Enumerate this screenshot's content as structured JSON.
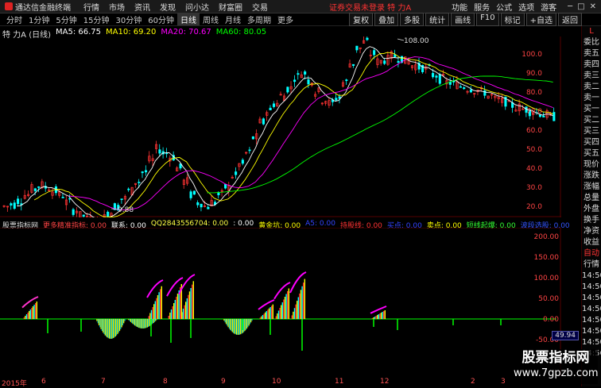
{
  "app": {
    "title": "通达信金融终端",
    "menu": [
      "行情",
      "市场",
      "资讯",
      "发现",
      "问小达",
      "财富圈",
      "交易"
    ],
    "notice": "证券交易未登录  特 力A",
    "right_menu": [
      "功能",
      "服务",
      "公式",
      "选项"
    ],
    "guest": "游客"
  },
  "toolbar": {
    "periods": [
      "分时",
      "1分钟",
      "5分钟",
      "15分钟",
      "30分钟",
      "60分钟",
      "日线",
      "周线",
      "月线",
      "多周期",
      "更多"
    ],
    "active": "日线",
    "actions": [
      "复权",
      "叠加",
      "多股",
      "统计",
      "画线",
      "F10",
      "标记",
      "+自选",
      "返回"
    ]
  },
  "info": {
    "name": "特 力A (日线)",
    "ma5": "MA5: 66.75",
    "ma10": "MA10: 69.20",
    "ma20": "MA20: 70.67",
    "ma60": "MA60: 80.05"
  },
  "price_axis": [
    "100.0",
    "90.0",
    "80.0",
    "70.0",
    "60.0",
    "50.0",
    "40.0",
    "30.0",
    "20.0"
  ],
  "price_labels": {
    "high": "108.00",
    "low": "9.88"
  },
  "indicator": {
    "title": "股票指标网",
    "items": [
      {
        "text": "更多精准指标: 0.00",
        "color": "#ff4444"
      },
      {
        "text": "联系: 0.00",
        "color": "#ffffff"
      },
      {
        "text": "QQ2843556704: 0.00",
        "color": "#ffff44"
      },
      {
        "text": ": 0.00",
        "color": "#ffffff"
      },
      {
        "text": "黄金坑: 0.00",
        "color": "#ffff00"
      },
      {
        "text": "A5: 0.00",
        "color": "#3344ff"
      },
      {
        "text": "持股线: 0.00",
        "color": "#ff3333"
      },
      {
        "text": "买点: 0.00",
        "color": "#3344ff"
      },
      {
        "text": "卖点: 0.00",
        "color": "#ffff00"
      },
      {
        "text": "短线起爆: 0.00",
        "color": "#33ff33"
      },
      {
        "text": "波段选股: 0.00",
        "color": "#3355ff"
      }
    ]
  },
  "ind_axis": [
    "200.00",
    "150.00",
    "100.00",
    "50.00",
    "0.00",
    "-50.00"
  ],
  "current_value": "49.94",
  "x_axis": [
    "2015年",
    "6",
    "7",
    "8",
    "9",
    "10",
    "11",
    "12",
    "2",
    "3"
  ],
  "side": [
    "L",
    "委比",
    "卖五",
    "卖四",
    "卖三",
    "卖二",
    "卖一",
    "买一",
    "买二",
    "买三",
    "买四",
    "买五",
    "现价",
    "涨跌",
    "涨幅",
    "总量",
    "外盘",
    "换手",
    "净资",
    "收益",
    "自动",
    "行情",
    "14:50",
    "14:50",
    "14:50",
    "14:50",
    "14:50",
    "14:50",
    "14:50",
    "14:56"
  ],
  "watermark": {
    "line1": "股票指标网",
    "line2": "www.7gpzb.com"
  },
  "colors": {
    "up": "#ff3333",
    "down": "#00ffff",
    "ma5": "#ffffff",
    "ma10": "#ffff00",
    "ma20": "#ff00ff",
    "ma60": "#00ff00"
  }
}
